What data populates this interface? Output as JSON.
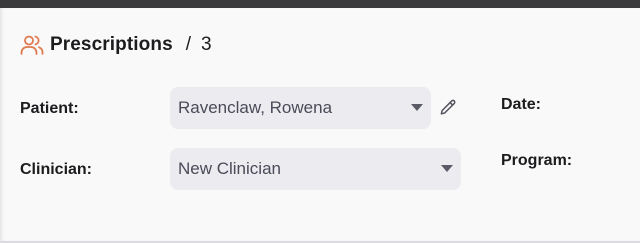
{
  "header": {
    "icon": "users-icon",
    "title": "Prescriptions",
    "separator": "/",
    "count": "3",
    "accent_color": "#e07a4f"
  },
  "form": {
    "patient": {
      "label": "Patient:",
      "value": "Ravenclaw, Rowena"
    },
    "clinician": {
      "label": "Clinician:",
      "value": "New Clinician"
    },
    "date": {
      "label": "Date:"
    },
    "program": {
      "label": "Program:"
    },
    "edit_icon": "pencil-icon"
  }
}
